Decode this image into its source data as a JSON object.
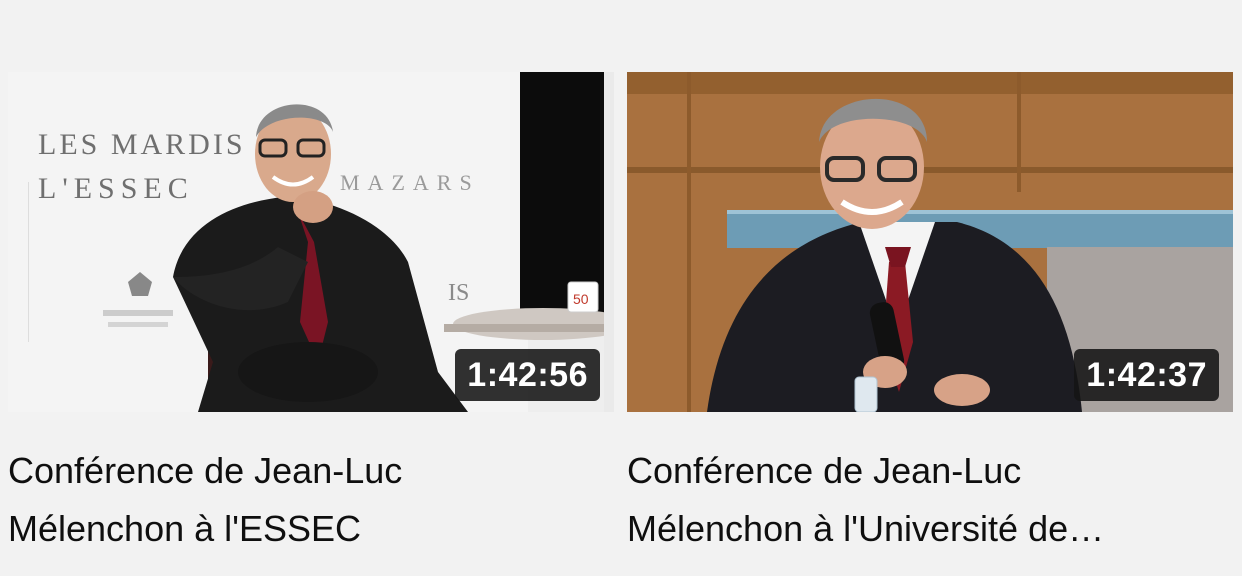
{
  "videos": [
    {
      "title": "Conférence de Jean-Luc Mélenchon à l'ESSEC",
      "duration": "1:42:56",
      "backdrop_text": {
        "line1": "LES MARDIS",
        "line2": "L'ESSEC",
        "sponsor": "MAZARS",
        "partial": "IS",
        "cup": "50"
      }
    },
    {
      "title": "Conférence de Jean-Luc Mélenchon à l'Université de…",
      "duration": "1:42:37"
    }
  ],
  "colors": {
    "page_background": "#f2f2f2",
    "title_text": "#0f0f0f",
    "duration_badge": "#141414",
    "duration_text": "#ffffff"
  }
}
